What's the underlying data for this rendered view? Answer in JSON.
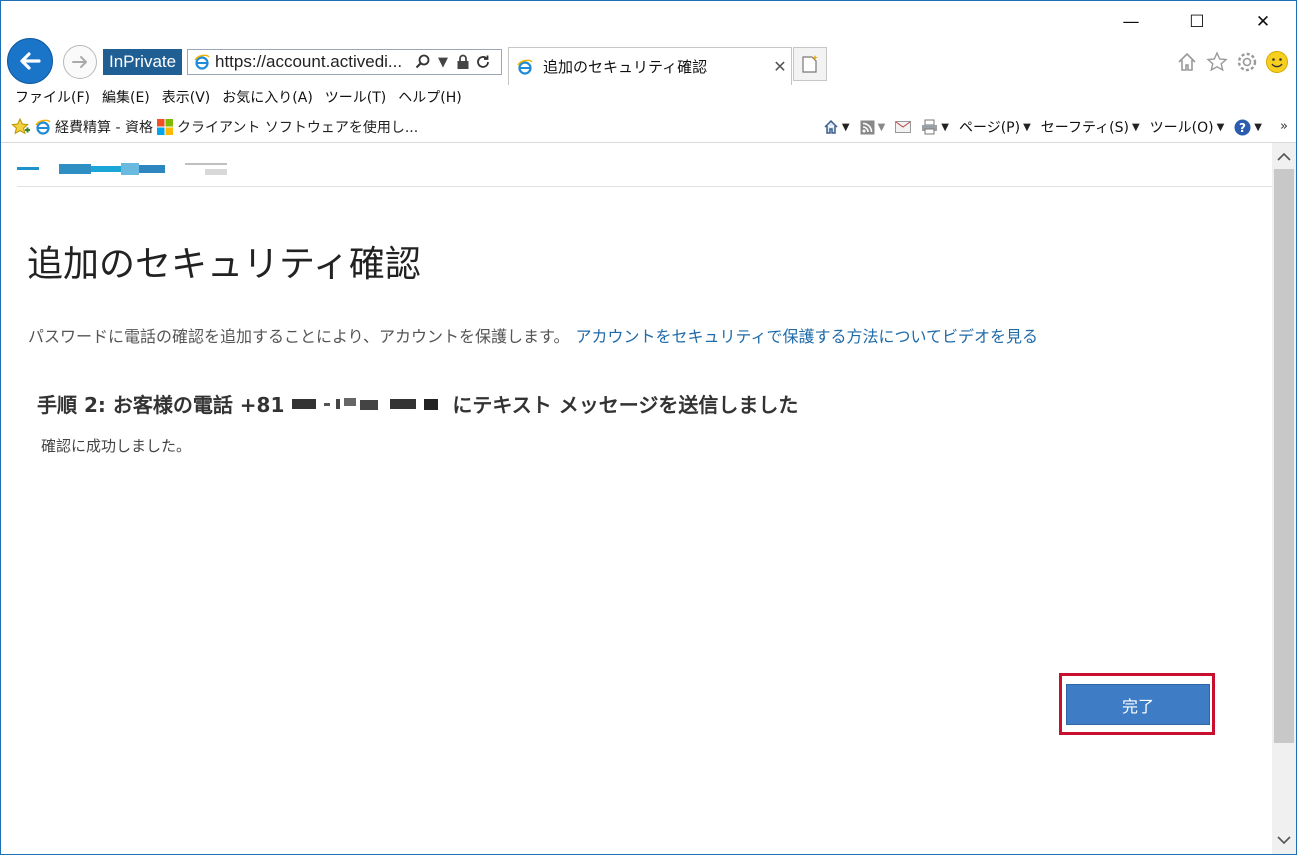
{
  "window": {
    "controls": {
      "minimize": "—",
      "maximize": "☐",
      "close": "✕"
    }
  },
  "nav": {
    "inprivate_label": "InPrivate",
    "url": "https://account.activedi...",
    "tab_title": "追加のセキュリティ確認",
    "tab_close": "✕"
  },
  "menu": {
    "items": [
      "ファイル(F)",
      "編集(E)",
      "表示(V)",
      "お気に入り(A)",
      "ツール(T)",
      "ヘルプ(H)"
    ]
  },
  "favorites": {
    "items": [
      "経費精算 - 資格",
      "クライアント ソフトウェアを使用し..."
    ]
  },
  "commandbar": {
    "page": "ページ(P)",
    "safety": "セーフティ(S)",
    "tools": "ツール(O)",
    "more": "»"
  },
  "page": {
    "title": "追加のセキュリティ確認",
    "description": "パスワードに電話の確認を追加することにより、アカウントを保護します。",
    "video_link": "アカウントをセキュリティで保護する方法についてビデオを見る",
    "step_prefix": "手順 2: お客様の電話 +81",
    "step_suffix": "にテキスト メッセージを送信しました",
    "success_message": "確認に成功しました。",
    "done_button": "完了"
  },
  "colors": {
    "accent": "#3f7cc6",
    "link": "#1f6aa8",
    "highlight": "#c8102e",
    "inprivate": "#1f5f93"
  }
}
